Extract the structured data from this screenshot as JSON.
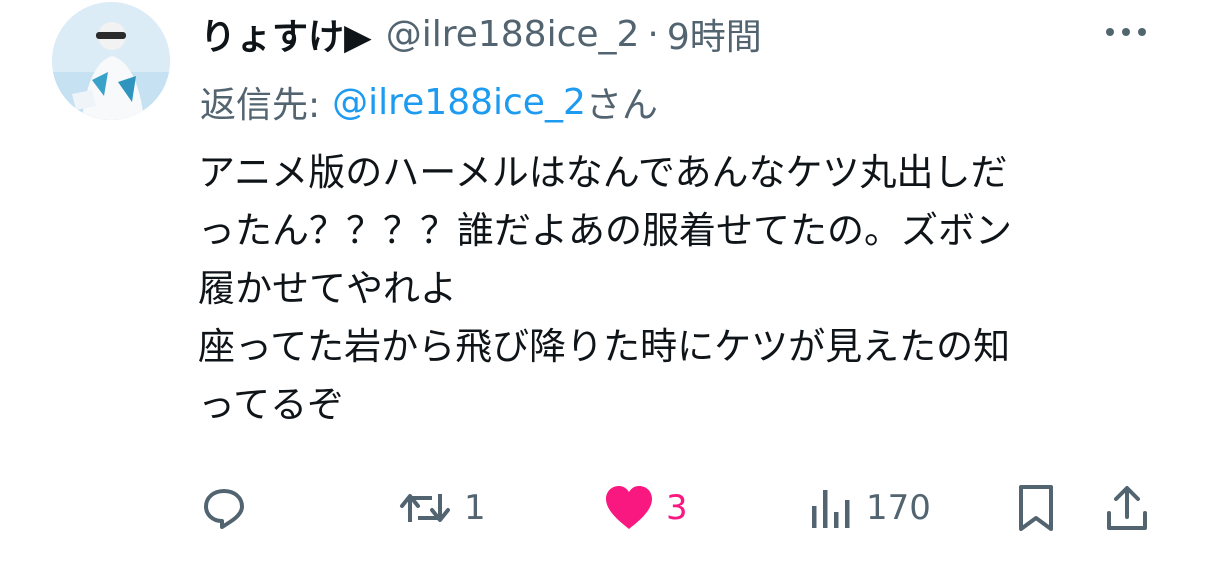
{
  "tweet": {
    "display_name": "りょすけ▶︎",
    "handle": "@ilre188ice_2",
    "separator": "·",
    "time": "9時間",
    "reply_prefix": "返信先:",
    "reply_handle": "@ilre188ice_2",
    "reply_suffix": "さん",
    "text_lines": [
      "アニメ版のハーメルはなんであんなケツ丸出しだ",
      "ったん？？？？誰だよあの服着せてたの。ズボン",
      "履かせてやれよ",
      "座ってた岩から飛び降りた時にケツが見えたの知",
      "ってるぞ"
    ]
  },
  "actions": {
    "reply_count": "",
    "retweet_count": "1",
    "like_count": "3",
    "views_count": "170"
  },
  "colors": {
    "text": "#0f1419",
    "secondary": "#536471",
    "link": "#1d9bf0",
    "like": "#f91880"
  },
  "icons": {
    "more": "more-dots-icon",
    "reply": "reply-icon",
    "retweet": "retweet-icon",
    "like": "heart-icon",
    "views": "views-icon",
    "bookmark": "bookmark-icon",
    "share": "share-icon"
  }
}
